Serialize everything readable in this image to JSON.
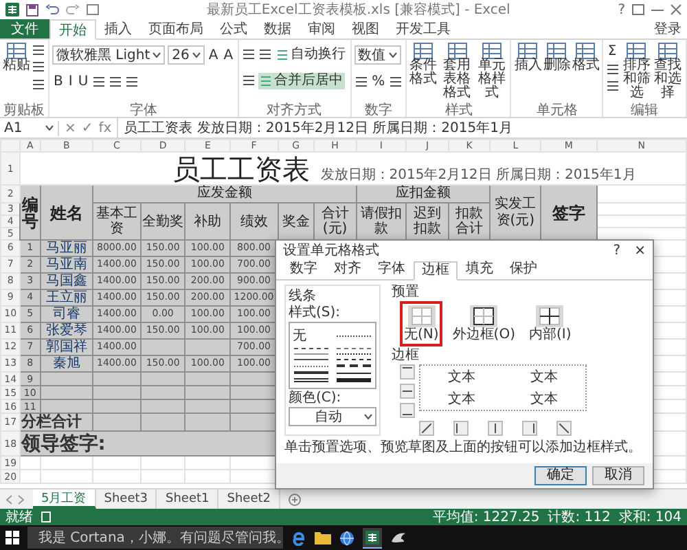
{
  "window": {
    "title": "最新员工Excel工资表模板.xls [兼容模式] - Excel",
    "help": "?"
  },
  "ribbon": {
    "tabs": [
      {
        "label": "文件",
        "kind": "file",
        "selected": false
      },
      {
        "label": "开始",
        "kind": "tab",
        "selected": true
      },
      {
        "label": "插入",
        "kind": "tab",
        "selected": false
      },
      {
        "label": "页面布局",
        "kind": "tab",
        "selected": false
      },
      {
        "label": "公式",
        "kind": "tab",
        "selected": false
      },
      {
        "label": "数据",
        "kind": "tab",
        "selected": false
      },
      {
        "label": "审阅",
        "kind": "tab",
        "selected": false
      },
      {
        "label": "视图",
        "kind": "tab",
        "selected": false
      },
      {
        "label": "开发工具",
        "kind": "tab",
        "selected": false
      }
    ],
    "account": "登录",
    "groups": [
      {
        "label": "剪贴板",
        "parts": [
          {
            "kind": "big",
            "label": "粘贴"
          },
          {
            "kind": "stack",
            "rows": [
              {
                "items": [
                  {
                    "kind": "icon"
                  }
                ]
              },
              {
                "items": [
                  {
                    "kind": "icon"
                  }
                ]
              },
              {
                "items": [
                  {
                    "kind": "icon"
                  }
                ]
              }
            ]
          }
        ]
      },
      {
        "label": "字体",
        "parts": [
          {
            "kind": "stack",
            "rows": [
              {
                "items": [
                  {
                    "kind": "field",
                    "label": "微软雅黑 Light"
                  },
                  {
                    "kind": "field",
                    "label": "26"
                  },
                  {
                    "kind": "text",
                    "label": "A"
                  },
                  {
                    "kind": "text",
                    "label": "A"
                  }
                ]
              },
              {
                "items": [
                  {
                    "kind": "text",
                    "label": "B"
                  },
                  {
                    "kind": "text",
                    "label": "I"
                  },
                  {
                    "kind": "text",
                    "label": "U"
                  },
                  {
                    "kind": "icon"
                  },
                  {
                    "kind": "icon"
                  },
                  {
                    "kind": "icon"
                  }
                ]
              }
            ]
          }
        ]
      },
      {
        "label": "对齐方式",
        "parts": [
          {
            "kind": "stack",
            "rows": [
              {
                "items": [
                  {
                    "kind": "icon"
                  },
                  {
                    "kind": "icon"
                  },
                  {
                    "kind": "toggle",
                    "label": "自动换行",
                    "on": false
                  }
                ]
              },
              {
                "items": [
                  {
                    "kind": "icon"
                  },
                  {
                    "kind": "toggle",
                    "label": "合并后居中",
                    "on": true
                  }
                ]
              }
            ]
          }
        ]
      },
      {
        "label": "数字",
        "parts": [
          {
            "kind": "stack",
            "rows": [
              {
                "items": [
                  {
                    "kind": "field",
                    "label": "数值"
                  }
                ]
              },
              {
                "items": [
                  {
                    "kind": "icon"
                  },
                  {
                    "kind": "text",
                    "label": "%"
                  },
                  {
                    "kind": "icon"
                  }
                ]
              }
            ]
          }
        ]
      },
      {
        "label": "样式",
        "parts": [
          {
            "kind": "big",
            "label": "条件格式"
          },
          {
            "kind": "big",
            "label": "套用表格格式"
          },
          {
            "kind": "big",
            "label": "单元格样式"
          }
        ]
      },
      {
        "label": "单元格",
        "parts": [
          {
            "kind": "big",
            "label": "插入"
          },
          {
            "kind": "big",
            "label": "删除"
          },
          {
            "kind": "big",
            "label": "格式"
          }
        ]
      },
      {
        "label": "编辑",
        "parts": [
          {
            "kind": "stack",
            "rows": [
              {
                "items": [
                  {
                    "kind": "text",
                    "label": "Σ"
                  }
                ]
              },
              {
                "items": [
                  {
                    "kind": "icon"
                  }
                ]
              },
              {
                "items": [
                  {
                    "kind": "icon"
                  }
                ]
              }
            ]
          },
          {
            "kind": "big",
            "label": "排序和筛选"
          },
          {
            "kind": "big",
            "label": "查找和选择"
          }
        ]
      }
    ]
  },
  "formula_bar": {
    "name_box": "A1",
    "cancel": "×",
    "enter": "✓",
    "fx": "fx",
    "formula": "员工工资表   发放日期：2015年2月12日  所属日期：2015年1月"
  },
  "sheet": {
    "columns": [
      "A",
      "B",
      "C",
      "D",
      "E",
      "F",
      "G",
      "H",
      "I",
      "J",
      "K",
      "L",
      "M",
      "N"
    ],
    "title_row": "1",
    "title": "员工工资表",
    "subtitle": "发放日期：2015年2月12日   所属日期：2015年1月",
    "header": {
      "row_numbers": [
        "2",
        "3",
        "4",
        "5"
      ],
      "number": "编号",
      "name": "姓名",
      "groups": [
        {
          "label": "应发金额",
          "columns": [
            "基本工资",
            "全勤奖",
            "补助",
            "绩效",
            "奖金",
            "合计(元)"
          ]
        },
        {
          "label": "应扣金额",
          "columns": [
            "请假扣款",
            "迟到扣款",
            "扣款合计"
          ]
        }
      ],
      "net": "实发工资(元)",
      "sign": "签字"
    },
    "rows": [
      {
        "row": "6",
        "no": "1",
        "name": "马亚丽",
        "values": {
          "C": "8000.00",
          "D": "150.00",
          "E": "100.00",
          "F": "800.00"
        }
      },
      {
        "row": "7",
        "no": "2",
        "name": "马亚南",
        "values": {
          "C": "1400.00",
          "D": "150.00",
          "E": "100.00",
          "F": "700.00"
        }
      },
      {
        "row": "8",
        "no": "3",
        "name": "马国鑫",
        "values": {
          "C": "1400.00",
          "D": "150.00",
          "E": "200.00",
          "F": "900.00"
        }
      },
      {
        "row": "9",
        "no": "4",
        "name": "王立丽",
        "values": {
          "C": "1400.00",
          "D": "150.00",
          "E": "200.00",
          "F": "1200.00"
        }
      },
      {
        "row": "10",
        "no": "5",
        "name": "司睿",
        "values": {
          "C": "1400.00",
          "D": "0.00",
          "E": "100.00",
          "F": "100.00"
        }
      },
      {
        "row": "11",
        "no": "6",
        "name": "张爱琴",
        "values": {
          "C": "1400.00",
          "D": "150.00",
          "E": "100.00",
          "F": "100.00"
        }
      },
      {
        "row": "12",
        "no": "7",
        "name": "郭国祥",
        "values": {
          "C": "1400.00",
          "F": "700.00"
        }
      },
      {
        "row": "13",
        "no": "8",
        "name": "秦旭",
        "values": {
          "C": "1400.00",
          "D": "150.00",
          "E": "100.00",
          "F": "100.00"
        }
      },
      {
        "row": "14",
        "no": "9"
      },
      {
        "row": "15",
        "no": "10"
      },
      {
        "row": "16",
        "no": "11"
      }
    ],
    "total_row": {
      "row": "17",
      "label": "分栏合计"
    },
    "sign_row": {
      "row": "18",
      "label": "领导签字:"
    },
    "empty_rows": [
      "19",
      "20"
    ]
  },
  "dialog": {
    "title": "设置单元格格式",
    "help": "?",
    "close": "×",
    "tabs": [
      {
        "label": "数字",
        "selected": false
      },
      {
        "label": "对齐",
        "selected": false
      },
      {
        "label": "字体",
        "selected": false
      },
      {
        "label": "边框",
        "selected": true
      },
      {
        "label": "填充",
        "selected": false
      },
      {
        "label": "保护",
        "selected": false
      }
    ],
    "line_group": "线条",
    "style_label": "样式(S):",
    "none_style": "无",
    "color_label": "颜色(C):",
    "color_value": "自动",
    "preset_label": "预置",
    "presets": [
      {
        "label": "无(N)",
        "selected": true
      },
      {
        "label": "外边框(O)",
        "selected": false
      },
      {
        "label": "内部(I)",
        "selected": false
      }
    ],
    "border_label": "边框",
    "preview_texts": [
      "文本",
      "文本",
      "文本",
      "文本"
    ],
    "hint": "单击预置选项、预览草图及上面的按钮可以添加边框样式。",
    "buttons": [
      "确定",
      "取消"
    ]
  },
  "sheet_tabs": {
    "tabs": [
      {
        "label": "5月工资",
        "selected": true
      },
      {
        "label": "Sheet3",
        "selected": false
      },
      {
        "label": "Sheet1",
        "selected": false
      },
      {
        "label": "Sheet2",
        "selected": false
      }
    ]
  },
  "status_bar": {
    "ready": "就绪",
    "stats": [
      "平均值: 1227.25",
      "计数: 112",
      "求和: 104"
    ]
  },
  "taskbar": {
    "search": "我是 Cortana，小娜。有问题尽管问我。"
  }
}
